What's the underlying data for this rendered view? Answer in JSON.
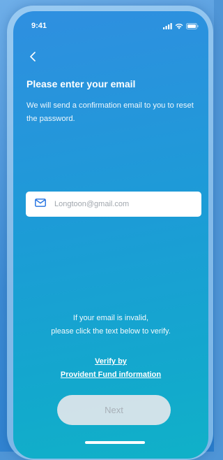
{
  "status_bar": {
    "time": "9:41",
    "icons": [
      "signal-icon",
      "wifi-icon",
      "battery-icon"
    ]
  },
  "nav": {
    "back_icon": "chevron-left-icon"
  },
  "content": {
    "title": "Please enter your email",
    "subtitle": "We will send a confirmation email to you to reset the password."
  },
  "email_input": {
    "icon": "mail-icon",
    "placeholder": "Longtoon@gmail.com",
    "value": ""
  },
  "helper": {
    "line1": "If your email is invalid,",
    "line2": "please click the text below to verify."
  },
  "verify_link": {
    "line1": "Verify by",
    "line2": "Provident Fund information"
  },
  "next_button": {
    "label": "Next",
    "state": "disabled"
  },
  "colors": {
    "gradient_start": "#2f8fe0",
    "gradient_end": "#10b1c8",
    "text": "#ffffff",
    "button_bg": "#e1e6eb",
    "button_text": "#a8b0b8"
  }
}
